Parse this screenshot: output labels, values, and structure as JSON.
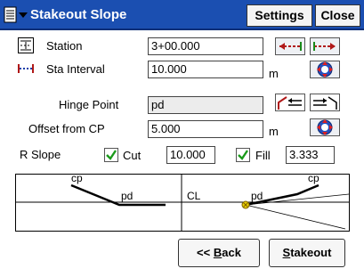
{
  "window": {
    "title": "Stakeout Slope",
    "settings_label": "Settings",
    "close_label": "Close"
  },
  "form": {
    "station_label": "Station",
    "station_value": "3+00.000",
    "sta_interval_label": "Sta Interval",
    "sta_interval_value": "10.000",
    "sta_interval_unit": "m",
    "hinge_point_label": "Hinge Point",
    "hinge_point_value": "pd",
    "offset_label": "Offset from CP",
    "offset_value": "5.000",
    "offset_unit": "m",
    "r_slope_label": "R Slope",
    "cut_label": "Cut",
    "cut_checked": true,
    "cut_value": "10.000",
    "fill_label": "Fill",
    "fill_checked": true,
    "fill_value": "3.333"
  },
  "graphic": {
    "label_cp_left": "cp",
    "label_pd_left": "pd",
    "label_cl": "CL",
    "label_pd_right": "pd",
    "label_cp_right": "cp"
  },
  "buttons": {
    "back_prefix": "<< ",
    "back_key": "B",
    "back_rest": "ack",
    "stakeout_key": "S",
    "stakeout_rest": "takeout"
  },
  "colors": {
    "titlebar": "#1b4fb1",
    "check": "#1a9a1a",
    "icon_red": "#b01818",
    "marker": "#e8d000"
  }
}
